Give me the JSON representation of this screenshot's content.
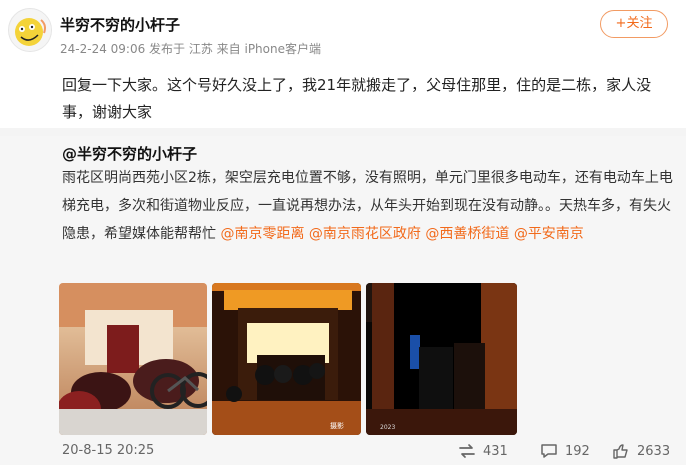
{
  "post": {
    "username": "半穷不穷的小杆子",
    "meta": "24-2-24 09:06  发布于 江苏  来自 iPhone客户端",
    "follow_label": "+关注",
    "reply_text": "回复一下大家。这个号好久没上了，我21年就搬走了，父母住那里，住的是二栋，家人没事，谢谢大家"
  },
  "quoted": {
    "username": "@半穷不穷的小杆子",
    "text_part1": "雨花区明尚西苑小区2栋，架空层充电位置不够，没有照明，单元门里很多电动车，还有电动车上电梯充电，多次和街道物业反应，一直说再想办法，从年头开始到现在没有动静。。天热车多，有失火隐患，希望媒体能帮帮忙",
    "mentions": [
      "@南京零距离",
      "@南京雨花区政府",
      "@西善桥街道",
      "@平安南京"
    ],
    "time": "20-8-15 20:25",
    "repost_count": "431",
    "comment_count": "192",
    "like_count": "2633"
  },
  "icons": {
    "repost": "repost-icon",
    "comment": "comment-icon",
    "like": "like-icon"
  },
  "colors": {
    "accent": "#f26a1b",
    "quote_bg": "#f6f6f6",
    "meta": "#888888"
  }
}
